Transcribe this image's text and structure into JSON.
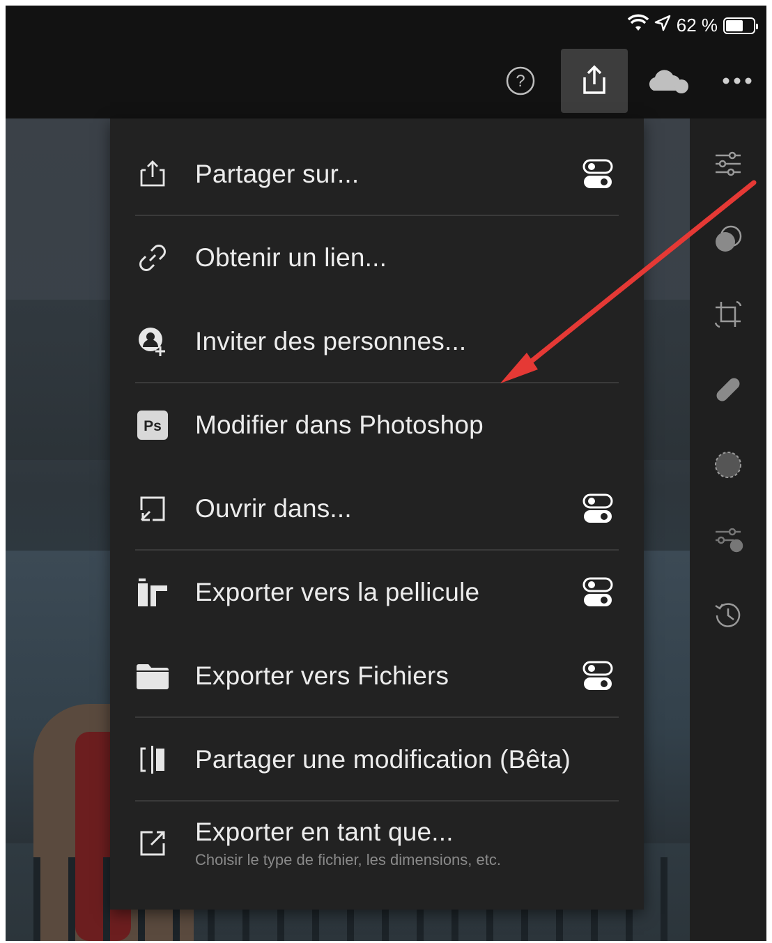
{
  "status_bar": {
    "wifi_icon": "wifi-icon",
    "location_icon": "location-arrow-icon",
    "battery_text": "62 %",
    "battery_level": 0.62
  },
  "toolbar": {
    "help_icon": "help-icon",
    "share_icon": "share-icon",
    "cloud_icon": "cloud-icon",
    "more_icon": "more-icon"
  },
  "share_menu": {
    "items": [
      {
        "label": "Partager sur...",
        "icon": "share-up-icon",
        "toggle": true
      },
      {
        "label": "Obtenir un lien...",
        "icon": "link-icon",
        "toggle": false
      },
      {
        "label": "Inviter des personnes...",
        "icon": "invite-person-icon",
        "toggle": false
      },
      {
        "label": "Modifier dans Photoshop",
        "icon": "photoshop-icon",
        "icon_text": "Ps",
        "toggle": false
      },
      {
        "label": "Ouvrir dans...",
        "icon": "open-in-icon",
        "toggle": true
      },
      {
        "label": "Exporter vers la pellicule",
        "icon": "camera-roll-icon",
        "toggle": true
      },
      {
        "label": "Exporter vers Fichiers",
        "icon": "folder-icon",
        "toggle": true
      },
      {
        "label": "Partager une modification (Bêta)",
        "icon": "compare-icon",
        "toggle": false
      },
      {
        "label": "Exporter en tant que...",
        "sublabel": "Choisir le type de fichier, les dimensions, etc.",
        "icon": "export-as-icon",
        "toggle": false
      }
    ]
  },
  "side_panel": {
    "icons": [
      "sliders-icon",
      "masking-icon",
      "crop-icon",
      "healing-icon",
      "selective-icon",
      "presets-icon",
      "history-icon"
    ]
  },
  "colors": {
    "menu_bg": "#222222",
    "toolbar_bg": "#121212",
    "active_button_bg": "#3d3d3d",
    "annotation_arrow": "#e53935"
  }
}
